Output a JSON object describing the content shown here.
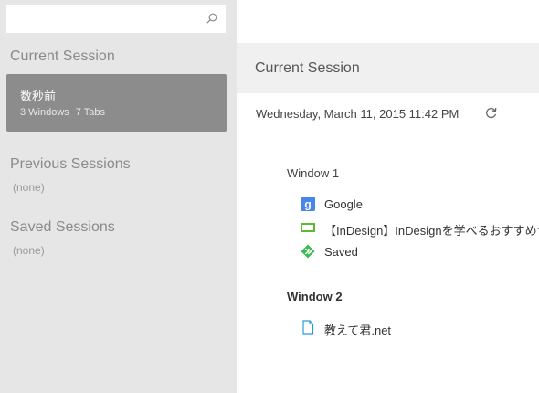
{
  "sidebar": {
    "search": {
      "value": "",
      "placeholder": ""
    },
    "current_heading": "Current Session",
    "current_card": {
      "time": "数秒前",
      "windows": "3 Windows",
      "tabs": "7 Tabs"
    },
    "previous_heading": "Previous Sessions",
    "previous_empty": "(none)",
    "saved_heading": "Saved Sessions",
    "saved_empty": "(none)"
  },
  "main": {
    "title": "Current Session",
    "date": "Wednesday, March 11, 2015 11:42 PM",
    "windows": [
      {
        "title": "Window 1",
        "tabs": [
          {
            "icon": "google-icon",
            "label": "Google"
          },
          {
            "icon": "indesign-icon",
            "label": "【InDesign】InDesignを学べるおすすめサ"
          },
          {
            "icon": "saved-icon",
            "label": "Saved"
          }
        ]
      },
      {
        "title": "Window 2",
        "tabs": [
          {
            "icon": "document-icon",
            "label": "教えて君.net"
          }
        ]
      }
    ]
  },
  "colors": {
    "sidebar_bg": "#e6e6e6",
    "selected_card": "#8c8c8c",
    "header_bg": "#f0f0f0",
    "google_blue": "#4a86e8",
    "indesign_green": "#5fb832",
    "saved_green": "#3cba54",
    "doc_blue": "#2b9bd8"
  }
}
